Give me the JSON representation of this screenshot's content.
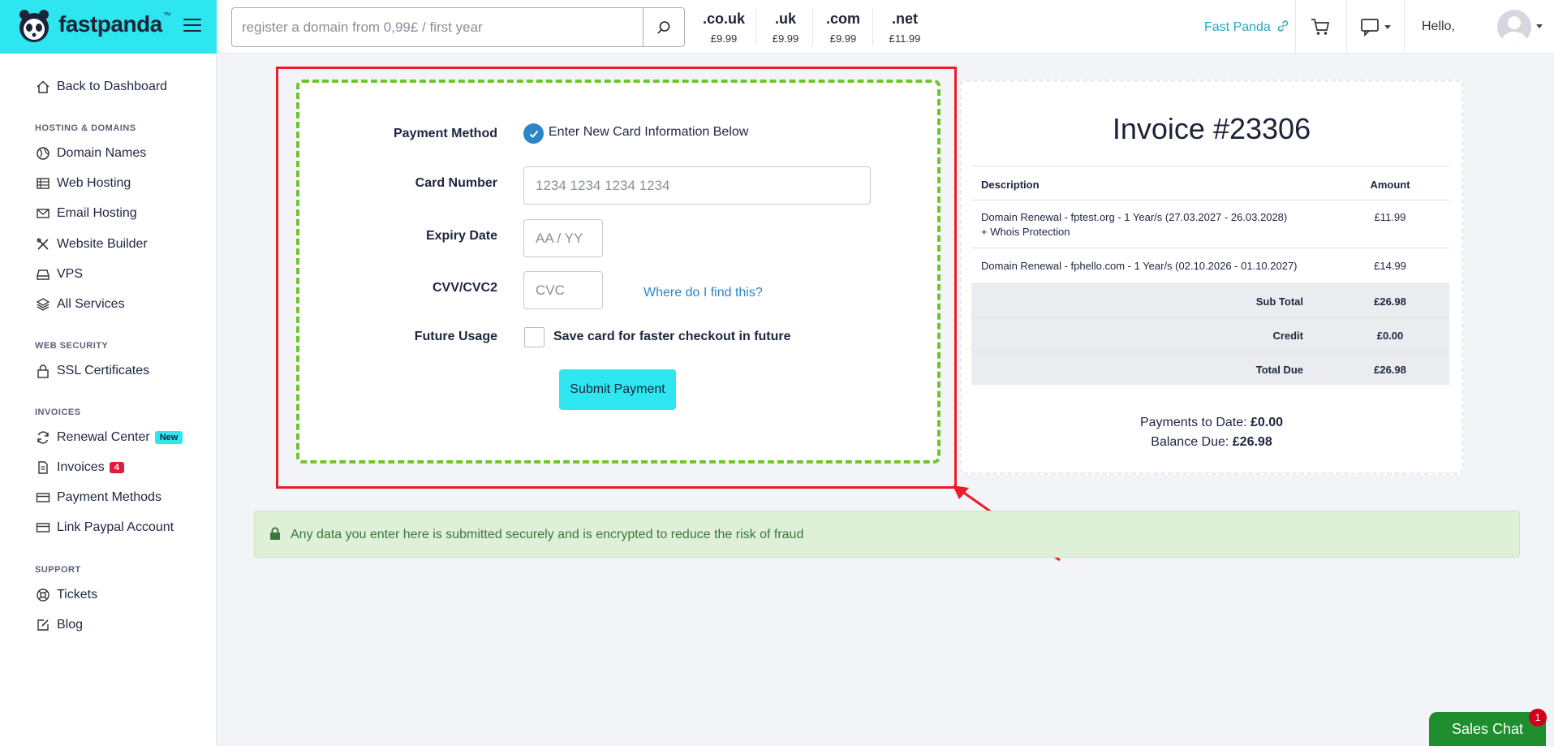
{
  "header": {
    "logo_text": "fastpanda",
    "logo_tm": "™",
    "search_placeholder": "register a domain from 0,99£ / first year",
    "tlds": [
      {
        "ext": ".co.uk",
        "price": "£9.99"
      },
      {
        "ext": ".uk",
        "price": "£9.99"
      },
      {
        "ext": ".com",
        "price": "£9.99"
      },
      {
        "ext": ".net",
        "price": "£11.99"
      }
    ],
    "fast_panda_link": "Fast Panda",
    "hello": "Hello,",
    "accent_color": "#2ee6f0"
  },
  "sidebar": {
    "back": "Back to Dashboard",
    "sections": [
      {
        "heading": "HOSTING & DOMAINS",
        "items": [
          "Domain Names",
          "Web Hosting",
          "Email Hosting",
          "Website Builder",
          "VPS",
          "All Services"
        ]
      },
      {
        "heading": "WEB SECURITY",
        "items": [
          "SSL Certificates"
        ]
      },
      {
        "heading": "INVOICES",
        "items": [
          "Renewal Center",
          "Invoices",
          "Payment Methods",
          "Link Paypal Account"
        ]
      },
      {
        "heading": "SUPPORT",
        "items": [
          "Tickets",
          "Blog"
        ]
      }
    ],
    "renewal_badge": "New",
    "invoices_badge": "4"
  },
  "payment": {
    "method_label": "Payment Method",
    "method_option": "Enter New Card Information Below",
    "card_label": "Card Number",
    "card_placeholder": "1234 1234 1234 1234",
    "expiry_label": "Expiry Date",
    "expiry_placeholder": "AA / YY",
    "cvv_label": "CVV/CVC2",
    "cvv_placeholder": "CVC",
    "cvv_help": "Where do I find this?",
    "future_label": "Future Usage",
    "save_card": "Save card for faster checkout in future",
    "submit": "Submit Payment"
  },
  "invoice": {
    "title": "Invoice #23306",
    "col_description": "Description",
    "col_amount": "Amount",
    "items": [
      {
        "desc_line1": "Domain Renewal - fptest.org - 1 Year/s (27.03.2027 - 26.03.2028)",
        "desc_line2": "+ Whois Protection",
        "amount": "£11.99"
      },
      {
        "desc_line1": "Domain Renewal - fphello.com - 1 Year/s (02.10.2026 - 01.10.2027)",
        "amount": "£14.99"
      }
    ],
    "subtotal_label": "Sub Total",
    "subtotal": "£26.98",
    "credit_label": "Credit",
    "credit": "£0.00",
    "total_label": "Total Due",
    "total": "£26.98",
    "payments_label": "Payments to Date:",
    "payments": "£0.00",
    "balance_label": "Balance Due:",
    "balance": "£26.98"
  },
  "secure_message": "Any data you enter here is submitted securely and is encrypted to reduce the risk of fraud",
  "chat": {
    "label": "Sales Chat",
    "badge": "1"
  }
}
